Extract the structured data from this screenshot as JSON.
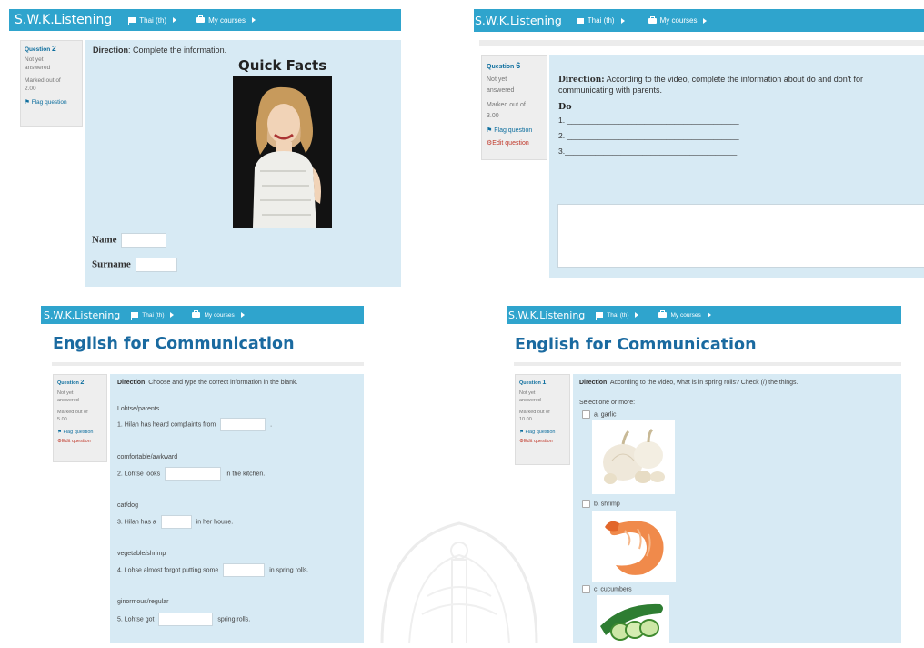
{
  "nav": {
    "brand": "S.W.K.Listening",
    "language": "Thai (th)",
    "courses": "My courses"
  },
  "course_title": "English for Communication",
  "p1": {
    "question_label": "Question",
    "question_number": "2",
    "status": "Not yet answered",
    "marked": "Marked out of 2.00",
    "flag": "Flag question",
    "direction_bold": "Direction",
    "direction_text": ": Complete the information.",
    "heading": "Quick Facts",
    "field1": "Name",
    "field2": "Surname"
  },
  "p2": {
    "question_label": "Question",
    "question_number": "6",
    "status": "Not yet answered",
    "marked": "Marked out of 3.00",
    "flag": "Flag question",
    "edit": "Edit question",
    "direction_bold": "Direction:",
    "direction_text": " According to the video, complete the information about do and don't for communicating with parents.",
    "do_label": "Do",
    "lines": [
      "1. ________________________________________",
      "2. ________________________________________",
      "3.________________________________________"
    ]
  },
  "p3": {
    "question_label": "Question",
    "question_number": "2",
    "status": "Not yet answered",
    "marked": "Marked out of 5.00",
    "flag": "Flag question",
    "edit": "Edit question",
    "direction_bold": "Direction",
    "direction_text": ": Choose and type the correct information in the blank.",
    "items": [
      {
        "options": "Lohtse/parents",
        "before": "1. Hilah has heard complaints from",
        "after": "."
      },
      {
        "options": "comfortable/awkward",
        "before": "2. Lohtse looks",
        "after": "in the kitchen."
      },
      {
        "options": "cat/dog",
        "before": "3. Hilah has a",
        "after": "in her house."
      },
      {
        "options": "vegetable/shrimp",
        "before": "4. Lohse almost forgot putting some",
        "after": "in spring rolls."
      },
      {
        "options": "ginormous/regular",
        "before": "5. Lohtse got",
        "after": "spring rolls."
      }
    ]
  },
  "p4": {
    "question_label": "Question",
    "question_number": "1",
    "status": "Not yet answered",
    "marked": "Marked out of 10.00",
    "flag": "Flag question",
    "edit": "Edit question",
    "direction_bold": "Direction",
    "direction_text": ": According to the video, what is in spring rolls? Check (/) the things.",
    "select_label": "Select one or more:",
    "choices": [
      "a. garlic",
      "b. shrimp",
      "c. cucumbers"
    ]
  },
  "colors": {
    "navbar": "#2fa4cd",
    "content_bg": "#d7eaf4",
    "title": "#1a6aa0",
    "info_bg": "#eeeeee"
  },
  "icons": [
    "flag-icon",
    "briefcase-icon",
    "caret-right-icon",
    "edit-icon",
    "checkbox-icon"
  ]
}
